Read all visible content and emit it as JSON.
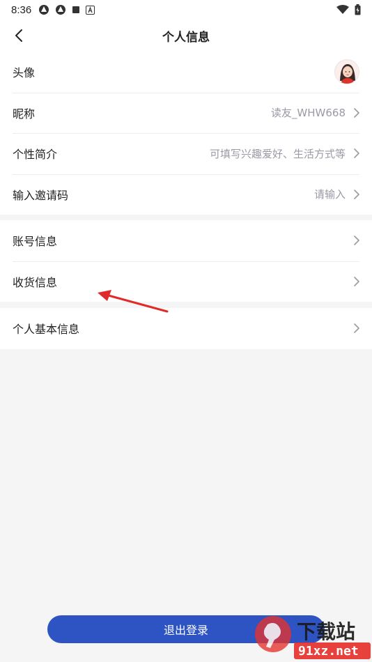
{
  "status_bar": {
    "time": "8:36"
  },
  "header": {
    "title": "个人信息"
  },
  "profile": {
    "avatar_label": "头像",
    "nickname_label": "昵称",
    "nickname_value": "读友_WHW668",
    "bio_label": "个性简介",
    "bio_placeholder": "可填写兴趣爱好、生活方式等",
    "invite_label": "输入邀请码",
    "invite_placeholder": "请输入"
  },
  "account": {
    "account_info_label": "账号信息",
    "shipping_info_label": "收货信息"
  },
  "basic": {
    "basic_info_label": "个人基本信息"
  },
  "footer": {
    "logout_label": "退出登录"
  },
  "watermark": {
    "brand": "下载站",
    "site": "91xz.net"
  },
  "colors": {
    "accent": "#2e53c2",
    "annotation_arrow": "#e02b2b",
    "secondary_text": "#9a9aa6"
  }
}
